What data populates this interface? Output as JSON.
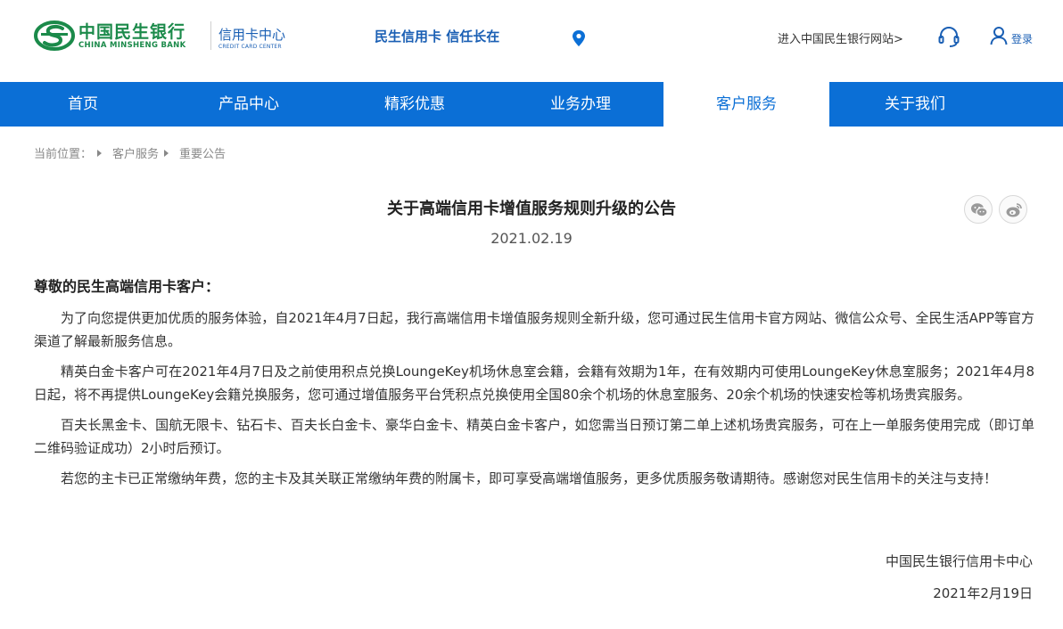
{
  "header": {
    "logo_cn": "中国民生银行",
    "logo_en": "CHINA MINSHENG BANK",
    "center_cn": "信用卡中心",
    "center_en": "CREDIT CARD CENTER",
    "slogan": "民生信用卡 信任长在",
    "enter_link": "进入中国民生银行网站>",
    "login": "登录",
    "icons": [
      "location-pin-icon",
      "headset-icon",
      "user-icon"
    ]
  },
  "nav": {
    "items": [
      {
        "label": "首页"
      },
      {
        "label": "产品中心"
      },
      {
        "label": "精彩优惠"
      },
      {
        "label": "业务办理"
      },
      {
        "label": "客户服务",
        "active": true
      },
      {
        "label": "关于我们"
      }
    ]
  },
  "breadcrumb": {
    "prefix": "当前位置：",
    "items": [
      "客户服务",
      "重要公告"
    ]
  },
  "article": {
    "title": "关于高端信用卡增值服务规则升级的公告",
    "date": "2021.02.19",
    "greeting": "尊敬的民生高端信用卡客户：",
    "paragraphs": [
      "为了向您提供更加优质的服务体验，自2021年4月7日起，我行高端信用卡增值服务规则全新升级，您可通过民生信用卡官方网站、微信公众号、全民生活APP等官方渠道了解最新服务信息。",
      "精英白金卡客户可在2021年4月7日及之前使用积点兑换LoungeKey机场休息室会籍，会籍有效期为1年，在有效期内可使用LoungeKey休息室服务；2021年4月8日起，将不再提供LoungeKey会籍兑换服务，您可通过增值服务平台凭积点兑换使用全国80余个机场的休息室服务、20余个机场的快速安检等机场贵宾服务。",
      "百夫长黑金卡、国航无限卡、钻石卡、百夫长白金卡、豪华白金卡、精英白金卡客户，如您需当日预订第二单上述机场贵宾服务，可在上一单服务使用完成（即订单二维码验证成功）2小时后预订。",
      "若您的主卡已正常缴纳年费，您的主卡及其关联正常缴纳年费的附属卡，即可享受高端增值服务，更多优质服务敬请期待。感谢您对民生信用卡的关注与支持！"
    ],
    "signature": "中国民生银行信用卡中心",
    "signature_date": "2021年2月19日"
  },
  "share": {
    "icons": [
      "wechat-icon",
      "weibo-icon"
    ]
  },
  "colors": {
    "brand_green": "#1b8a4a",
    "nav_blue": "#0b6fd6",
    "text_blue": "#1a5fb4"
  }
}
